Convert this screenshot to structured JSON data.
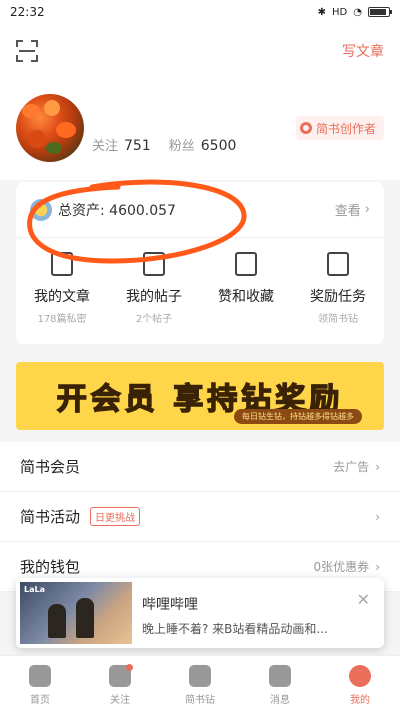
{
  "status_bar": {
    "time": "22:32",
    "signal_label": "HD",
    "battery_percent": 90
  },
  "header": {
    "write_label": "写文章"
  },
  "profile": {
    "following_label": "关注",
    "following_count": "751",
    "followers_label": "粉丝",
    "followers_count": "6500",
    "creator_badge": "简书创作者"
  },
  "assets": {
    "label": "总资产: 4600.057",
    "view_label": "查看"
  },
  "shortcuts": [
    {
      "title": "我的文章",
      "sub": "178篇私密",
      "icon": "article-icon"
    },
    {
      "title": "我的帖子",
      "sub": "2个帖子",
      "icon": "post-icon"
    },
    {
      "title": "赞和收藏",
      "sub": "",
      "icon": "like-collect-icon"
    },
    {
      "title": "奖励任务",
      "sub": "领简书钻",
      "icon": "reward-task-icon"
    }
  ],
  "banner": {
    "title": "开会员 享持钻奖励",
    "subtitle": "每日钻生钻，持钻越多得钻越多"
  },
  "menu": [
    {
      "label": "简书会员",
      "right": "去广告",
      "tag": ""
    },
    {
      "label": "简书活动",
      "right": "",
      "tag": "日更挑战"
    },
    {
      "label": "我的钱包",
      "right": "0张优惠券",
      "tag": ""
    }
  ],
  "popup": {
    "thumb_label": "LaLa",
    "title": "哔哩哔哩",
    "desc": "晚上睡不着? 来B站看精品动画和...",
    "close_glyph": "✕"
  },
  "tabs": [
    {
      "label": "首页",
      "icon": "home-icon",
      "active": false,
      "dot": false
    },
    {
      "label": "关注",
      "icon": "follow-icon",
      "active": false,
      "dot": true
    },
    {
      "label": "简书钻",
      "icon": "diamond-icon",
      "active": false,
      "dot": false
    },
    {
      "label": "消息",
      "icon": "message-icon",
      "active": false,
      "dot": false
    },
    {
      "label": "我的",
      "icon": "profile-icon",
      "active": true,
      "dot": false
    }
  ],
  "colors": {
    "accent": "#ea6f5a",
    "annotation": "#ff5a1a",
    "banner": "#ffd54a"
  }
}
